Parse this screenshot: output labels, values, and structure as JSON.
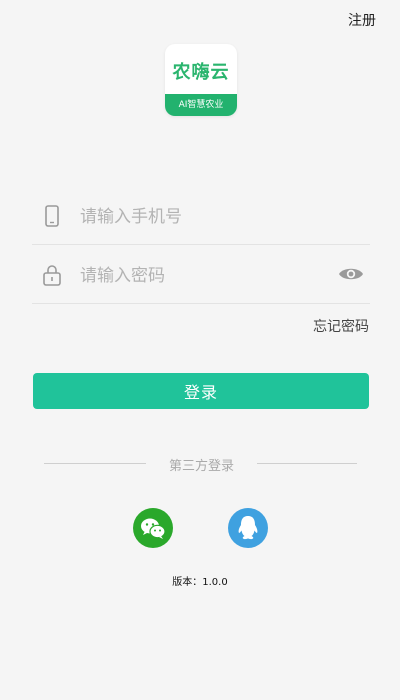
{
  "header": {
    "register_label": "注册"
  },
  "logo": {
    "title": "农嗨云",
    "tagline": "AI智慧农业"
  },
  "form": {
    "phone_placeholder": "请输入手机号",
    "password_placeholder": "请输入密码",
    "forgot_label": "忘记密码",
    "login_label": "登录"
  },
  "third_party": {
    "label": "第三方登录",
    "options": [
      {
        "name": "wechat",
        "icon": "wechat-icon",
        "color": "#2aa82b"
      },
      {
        "name": "qq",
        "icon": "qq-icon",
        "color": "#3fa1e0"
      }
    ]
  },
  "footer": {
    "version": "版本：1.0.0"
  },
  "colors": {
    "accent": "#20c39a",
    "logo_green": "#22b26e"
  }
}
